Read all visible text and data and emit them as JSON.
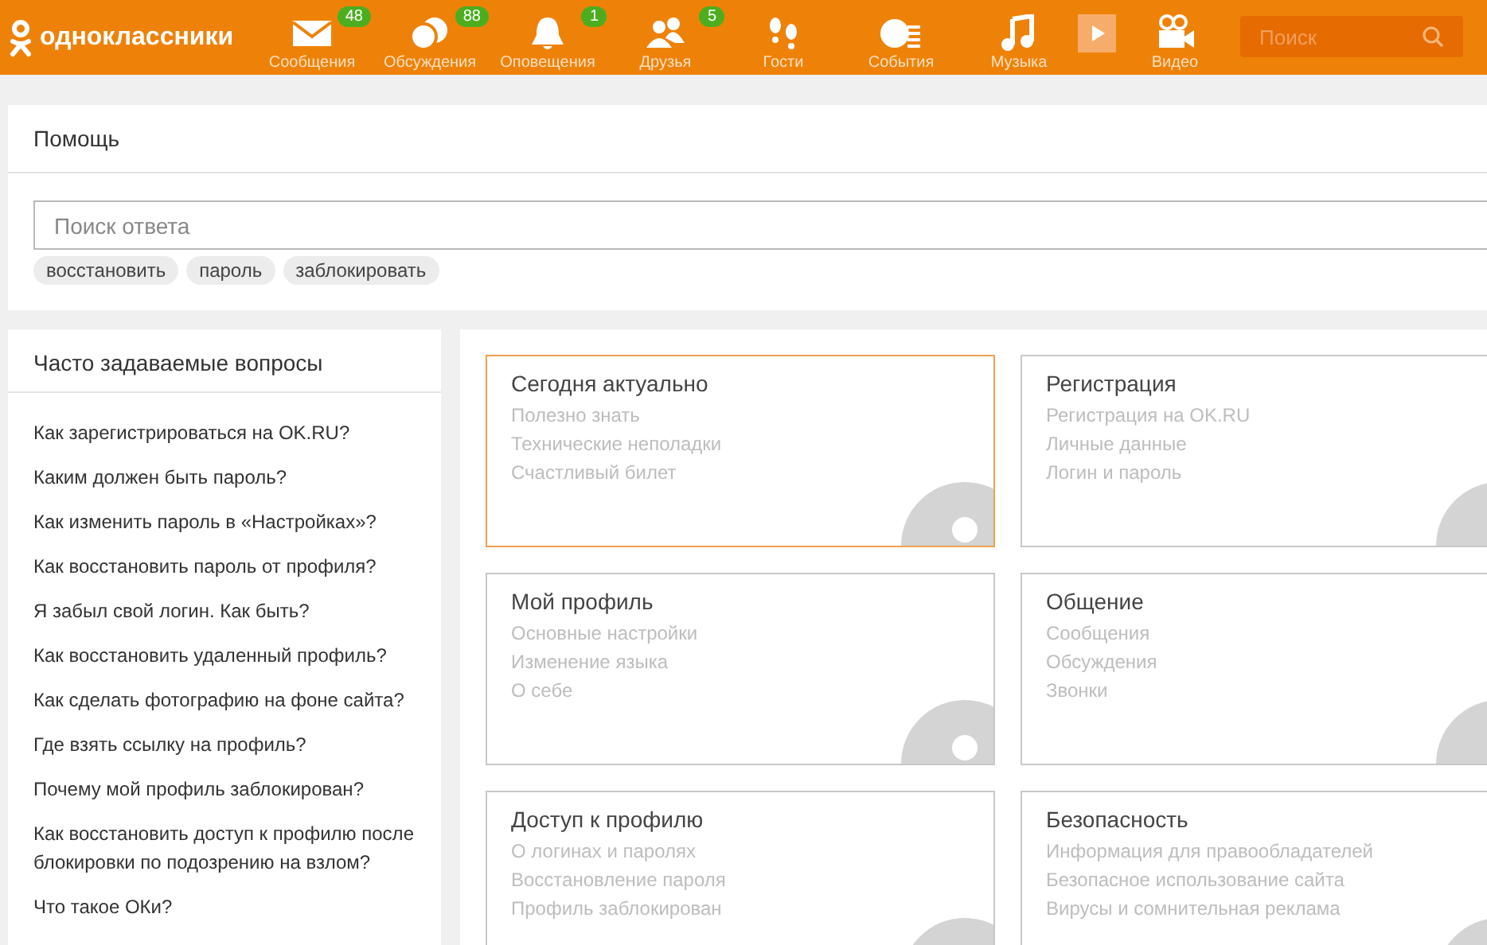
{
  "header": {
    "logo": "одноклассники",
    "nav": [
      {
        "label": "Сообщения",
        "badge": "48"
      },
      {
        "label": "Обсуждения",
        "badge": "88"
      },
      {
        "label": "Оповещения",
        "badge": "1"
      },
      {
        "label": "Друзья",
        "badge": "5"
      },
      {
        "label": "Гости"
      },
      {
        "label": "События"
      },
      {
        "label": "Музыка"
      },
      {
        "label": "Видео"
      }
    ],
    "search": {
      "placeholder": "Поиск"
    }
  },
  "help": {
    "title": "Помощь",
    "search": {
      "placeholder": "Поиск ответа"
    },
    "tags": [
      "восстановить",
      "пароль",
      "заблокировать"
    ]
  },
  "faq": {
    "title": "Часто задаваемые вопросы",
    "items": [
      "Как зарегистрироваться на OK.RU?",
      "Каким должен быть пароль?",
      "Как изменить пароль в «Настройках»?",
      "Как восстановить пароль от профиля?",
      "Я забыл свой логин. Как быть?",
      "Как восстановить удаленный профиль?",
      "Как сделать фотографию на фоне сайта?",
      "Где взять ссылку на профиль?",
      "Почему мой профиль заблокирован?",
      "Как восстановить доступ к профилю после блокировки по подозрению на взлом?",
      "Что такое ОКи?"
    ]
  },
  "categories": [
    {
      "title": "Сегодня актуально",
      "selected": true,
      "links": [
        "Полезно знать",
        "Технические неполадки",
        "Счастливый билет"
      ]
    },
    {
      "title": "Регистрация",
      "selected": false,
      "links": [
        "Регистрация на OK.RU",
        "Личные данные",
        "Логин и пароль"
      ]
    },
    {
      "title": "Мой профиль",
      "selected": false,
      "links": [
        "Основные настройки",
        "Изменение языка",
        "О себе"
      ]
    },
    {
      "title": "Общение",
      "selected": false,
      "links": [
        "Сообщения",
        "Обсуждения",
        "Звонки"
      ]
    },
    {
      "title": "Доступ к профилю",
      "selected": false,
      "links": [
        "О логинах и паролях",
        "Восстановление пароля",
        "Профиль заблокирован"
      ]
    },
    {
      "title": "Безопасность",
      "selected": false,
      "links": [
        "Информация для правообладателей",
        "Безопасное использование сайта",
        "Вирусы и сомнительная реклама"
      ]
    }
  ]
}
